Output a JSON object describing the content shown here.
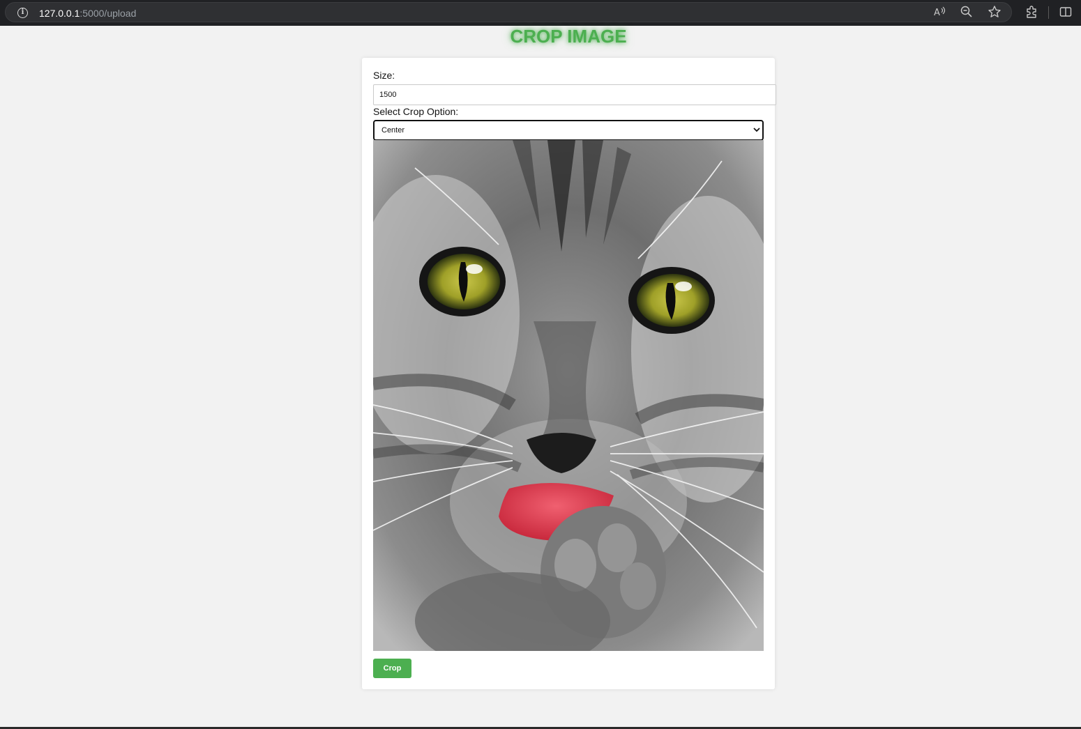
{
  "browser": {
    "url_host": "127.0.0.1",
    "url_path": ":5000/upload",
    "icons": [
      "info-icon",
      "read-aloud-icon",
      "zoom-out-icon",
      "favorite-star-icon",
      "extensions-icon",
      "split-screen-icon"
    ]
  },
  "page": {
    "title": "CROP IMAGE",
    "accent_color": "#4caf50"
  },
  "form": {
    "size_label": "Size:",
    "size_value": "1500",
    "crop_option_label": "Select Crop Option:",
    "crop_option_selected": "Center",
    "crop_button_label": "Crop"
  },
  "image": {
    "subject": "cat-photo"
  }
}
